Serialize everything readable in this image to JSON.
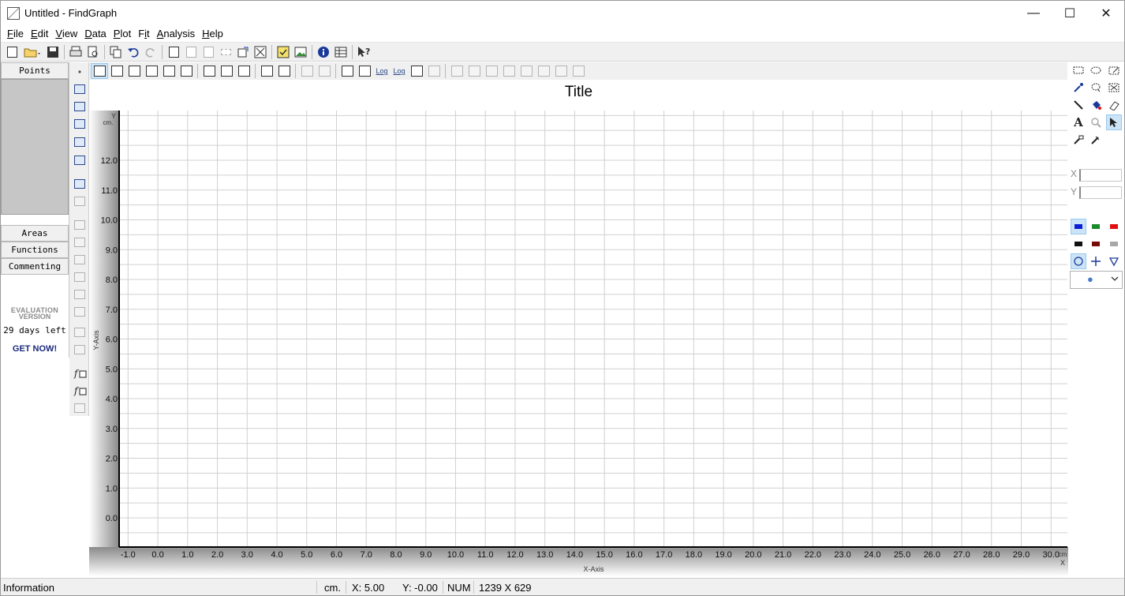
{
  "window": {
    "title": "Untitled - FindGraph",
    "controls": {
      "minimize": "—",
      "maximize": "☐",
      "close": "✕"
    }
  },
  "menu": [
    "File",
    "Edit",
    "View",
    "Data",
    "Plot",
    "Fit",
    "Analysis",
    "Help"
  ],
  "menu_underline": [
    "F",
    "E",
    "V",
    "D",
    "P",
    "i",
    "A",
    "H"
  ],
  "left_panel": {
    "points": "Points",
    "areas": "Areas",
    "functions": "Functions",
    "commenting": "Commenting",
    "eval_line1": "EVALUATION",
    "eval_line2": "VERSION",
    "days_left": "29 days left",
    "get_now": "GET NOW!"
  },
  "toolbar2": {
    "log1": "Log",
    "log2": "Log"
  },
  "right_panel": {
    "x_label": "X",
    "y_label": "Y",
    "colors": [
      "#0a1fd6",
      "#1a8a2a",
      "#e01010",
      "#111111",
      "#7a0a0a",
      "#a8a8a8"
    ],
    "marker_value": "●"
  },
  "chart_data": {
    "type": "scatter",
    "title": "Title",
    "xlabel": "X-Axis",
    "ylabel": "Y-Axis",
    "x_unit": "cm",
    "y_unit": "cm.",
    "x_axis_letter": "X",
    "y_axis_letter": "Y",
    "xlim": [
      -1.0,
      30.0
    ],
    "ylim": [
      0.0,
      12.0
    ],
    "x_ticks": [
      "-1.0",
      "0.0",
      "1.0",
      "2.0",
      "3.0",
      "4.0",
      "5.0",
      "6.0",
      "7.0",
      "8.0",
      "9.0",
      "10.0",
      "11.0",
      "12.0",
      "13.0",
      "14.0",
      "15.0",
      "16.0",
      "17.0",
      "18.0",
      "19.0",
      "20.0",
      "21.0",
      "22.0",
      "23.0",
      "24.0",
      "25.0",
      "26.0",
      "27.0",
      "28.0",
      "29.0",
      "30.0"
    ],
    "y_ticks": [
      "0.0",
      "1.0",
      "2.0",
      "3.0",
      "4.0",
      "5.0",
      "6.0",
      "7.0",
      "8.0",
      "9.0",
      "10.0",
      "11.0",
      "12.0"
    ],
    "grid": true,
    "series": []
  },
  "status": {
    "info": "Information",
    "unit": "cm.",
    "x": "X:  5.00",
    "y": "Y: -0.00",
    "num": "NUM",
    "size": "1239 X 629"
  }
}
